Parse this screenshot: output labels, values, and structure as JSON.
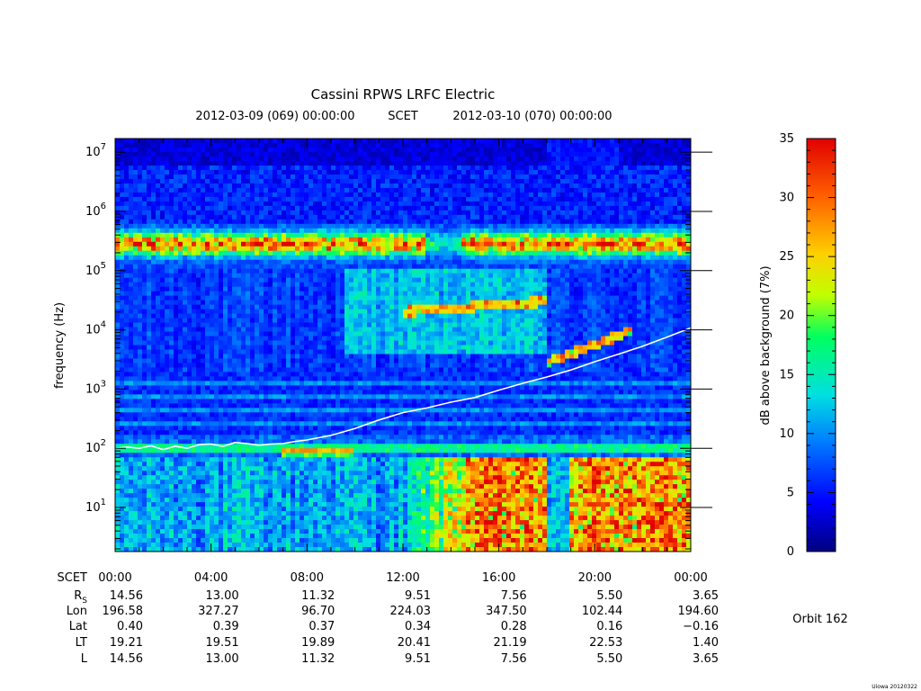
{
  "chart_data": {
    "type": "heatmap",
    "title": "Cassini RPWS LRFC Electric",
    "subtitle": {
      "start": "2012-03-09 (069) 00:00:00",
      "frame": "SCET",
      "end": "2012-03-10 (070) 00:00:00"
    },
    "ylabel": "frequency (Hz)",
    "yscale": "log",
    "ylim": [
      1.8,
      17000000
    ],
    "ytick_values": [
      10,
      100,
      1000,
      10000,
      100000,
      1000000,
      10000000
    ],
    "ytick_exponents": [
      "1",
      "2",
      "3",
      "4",
      "5",
      "6",
      "7"
    ],
    "ytick_base": "10",
    "xlim_hours": [
      0,
      24
    ],
    "xtick_hours": [
      0,
      4,
      8,
      12,
      16,
      20,
      24
    ],
    "colorbar": {
      "label": "dB above background (7%)",
      "range": [
        0,
        35
      ],
      "ticks": [
        "0",
        "5",
        "10",
        "15",
        "20",
        "25",
        "30",
        "35"
      ],
      "colors": [
        "#00007f",
        "#0000ff",
        "#0080ff",
        "#00e0e0",
        "#00ff60",
        "#c0ff00",
        "#ffd000",
        "#ff6000",
        "#e00000"
      ]
    },
    "overlay_line": {
      "color": "#ffffff",
      "points_hours_hz": [
        [
          0,
          100
        ],
        [
          0.5,
          105
        ],
        [
          1,
          100
        ],
        [
          1.5,
          110
        ],
        [
          2,
          95
        ],
        [
          2.5,
          108
        ],
        [
          3,
          100
        ],
        [
          3.5,
          115
        ],
        [
          4,
          118
        ],
        [
          4.5,
          108
        ],
        [
          5,
          125
        ],
        [
          5.5,
          120
        ],
        [
          6,
          112
        ],
        [
          6.5,
          118
        ],
        [
          7,
          120
        ],
        [
          7.5,
          130
        ],
        [
          8,
          138
        ],
        [
          9,
          165
        ],
        [
          10,
          215
        ],
        [
          11,
          300
        ],
        [
          12,
          400
        ],
        [
          13,
          480
        ],
        [
          14,
          600
        ],
        [
          15,
          720
        ],
        [
          16,
          960
        ],
        [
          17,
          1250
        ],
        [
          18,
          1600
        ],
        [
          19,
          2100
        ],
        [
          20,
          2900
        ],
        [
          21,
          3900
        ],
        [
          22,
          5300
        ],
        [
          23,
          7500
        ],
        [
          24,
          10800
        ]
      ]
    }
  },
  "ephemeris": {
    "rows": [
      {
        "label": "SCET",
        "values": [
          "00:00",
          "04:00",
          "08:00",
          "12:00",
          "16:00",
          "20:00",
          "00:00"
        ]
      },
      {
        "label": "R",
        "sub": "S",
        "values": [
          "14.56",
          "13.00",
          "11.32",
          "9.51",
          "7.56",
          "5.50",
          "3.65"
        ]
      },
      {
        "label": "Lon",
        "values": [
          "196.58",
          "327.27",
          "96.70",
          "224.03",
          "347.50",
          "102.44",
          "194.60"
        ]
      },
      {
        "label": "Lat",
        "values": [
          "0.40",
          "0.39",
          "0.37",
          "0.34",
          "0.28",
          "0.16",
          "−0.16"
        ]
      },
      {
        "label": "LT",
        "values": [
          "19.21",
          "19.51",
          "19.89",
          "20.41",
          "21.19",
          "22.53",
          "1.40"
        ]
      },
      {
        "label": "L",
        "values": [
          "14.56",
          "13.00",
          "11.32",
          "9.51",
          "7.56",
          "5.50",
          "3.65"
        ]
      }
    ]
  },
  "orbit_label": "Orbit 162",
  "footer_stamp": "Uiowa 20120322"
}
